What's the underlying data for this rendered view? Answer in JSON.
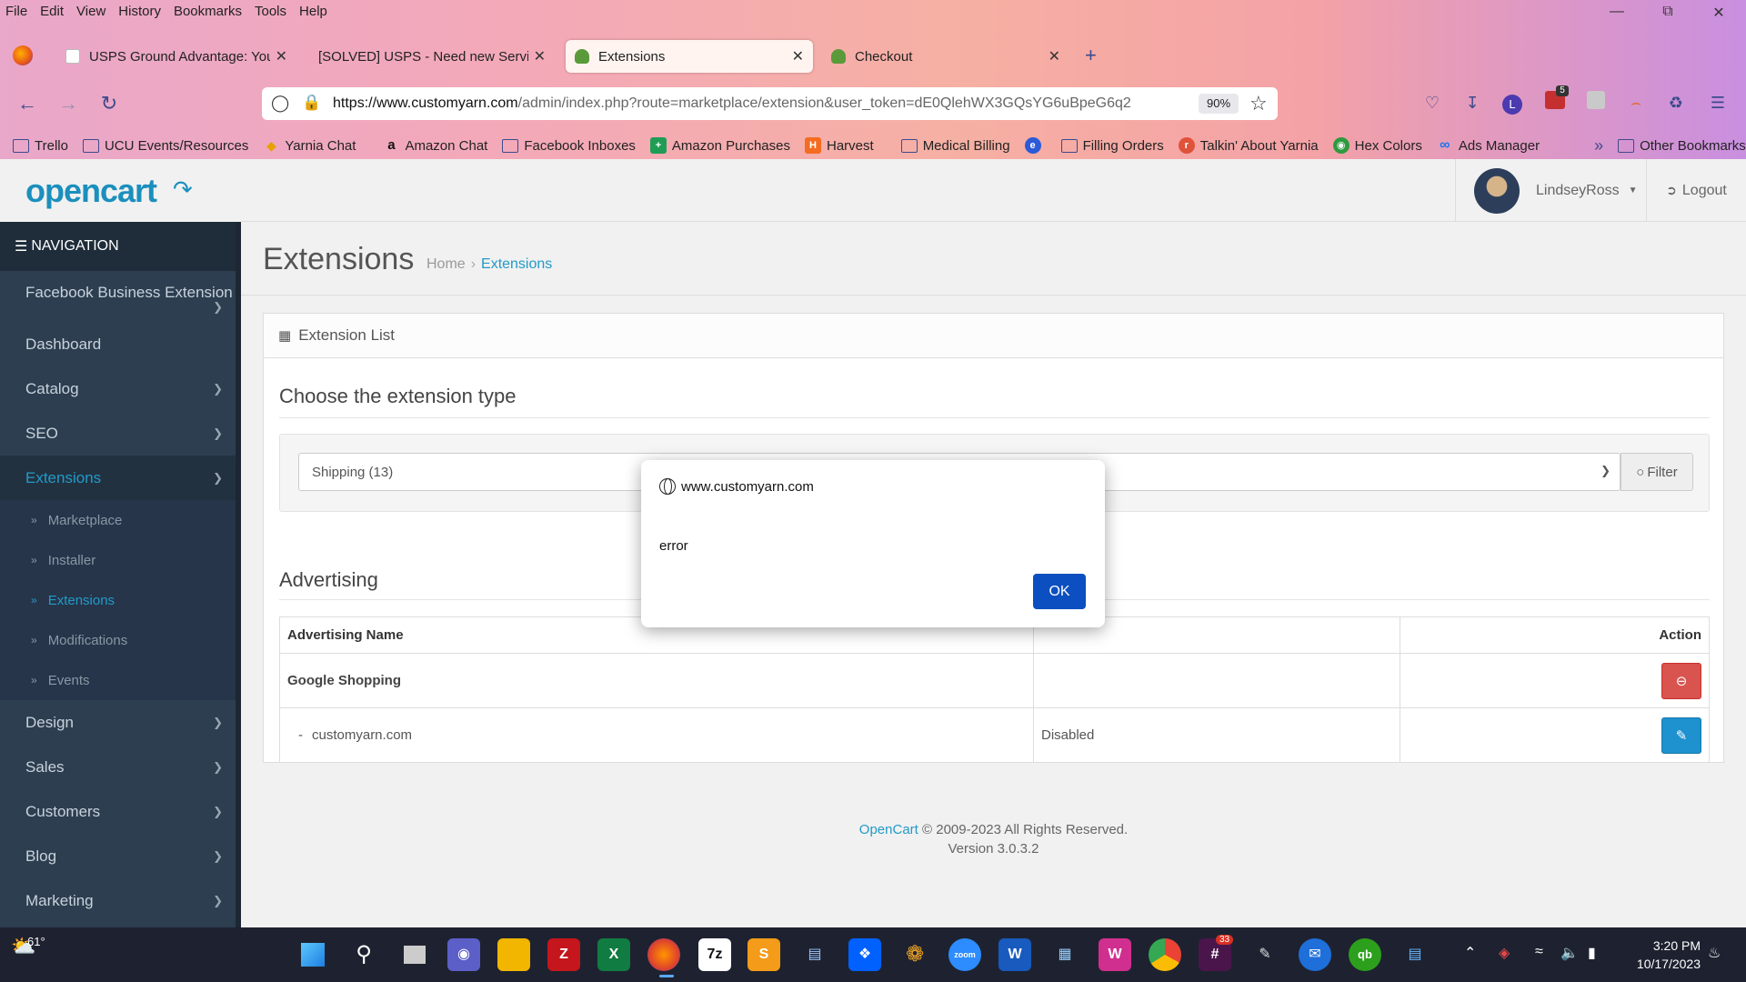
{
  "browser": {
    "menu": [
      "File",
      "Edit",
      "View",
      "History",
      "Bookmarks",
      "Tools",
      "Help"
    ],
    "tabs": [
      {
        "title": "USPS Ground Advantage: You are",
        "active": false
      },
      {
        "title": "[SOLVED] USPS - Need new Service",
        "active": false
      },
      {
        "title": "Extensions",
        "active": true
      },
      {
        "title": "Checkout",
        "active": false
      }
    ],
    "url_host": "https://www.customyarn.com",
    "url_path": "/admin/index.php?route=marketplace/extension&user_token=dE0QlehWX3GQsYG6uBpeG6q2",
    "zoom": "90%",
    "profile_letter": "L",
    "ext_badge": "5",
    "bookmarks": [
      "Trello",
      "UCU Events/Resources",
      "Yarnia Chat",
      "Amazon Chat",
      "Facebook Inboxes",
      "Amazon Purchases",
      "Harvest",
      "Medical Billing",
      "Filling Orders",
      "Talkin' About Yarnia",
      "Hex Colors",
      "Ads Manager"
    ],
    "other_bookmarks": "Other Bookmarks"
  },
  "header": {
    "logo": "opencart",
    "user": "LindseyRoss",
    "logout": "Logout"
  },
  "sidebar": {
    "heading": "NAVIGATION",
    "items": [
      {
        "label": "Facebook Business Extension"
      },
      {
        "label": "Dashboard"
      },
      {
        "label": "Catalog"
      },
      {
        "label": "SEO"
      },
      {
        "label": "Extensions"
      }
    ],
    "sub": [
      "Marketplace",
      "Installer",
      "Extensions",
      "Modifications",
      "Events"
    ],
    "items2": [
      "Design",
      "Sales",
      "Customers",
      "Blog",
      "Marketing"
    ]
  },
  "page": {
    "title": "Extensions",
    "breadcrumb": [
      "Home",
      "Extensions"
    ],
    "panel_title": "Extension List",
    "choose_heading": "Choose the extension type",
    "select_value": "Shipping (13)",
    "filter_label": "Filter",
    "section_title": "Advertising",
    "table": {
      "headers": [
        "Advertising Name",
        "",
        "Action"
      ],
      "group": "Google Shopping",
      "row": {
        "name": "customyarn.com",
        "status": "Disabled"
      }
    },
    "footer_link": "OpenCart",
    "footer_text": "© 2009-2023 All Rights Reserved.",
    "footer_version": "Version 3.0.3.2"
  },
  "dialog": {
    "origin": "www.customyarn.com",
    "message": "error",
    "ok": "OK"
  },
  "taskbar": {
    "weather": "61°",
    "time": "3:20 PM",
    "date": "10/17/2023",
    "badge": "33"
  },
  "colors": {
    "accent": "#229ac8",
    "sidebar": "#2c3e50",
    "danger": "#d9534f",
    "primary": "#1e91cf",
    "dialog_button": "#0b4fc0"
  }
}
